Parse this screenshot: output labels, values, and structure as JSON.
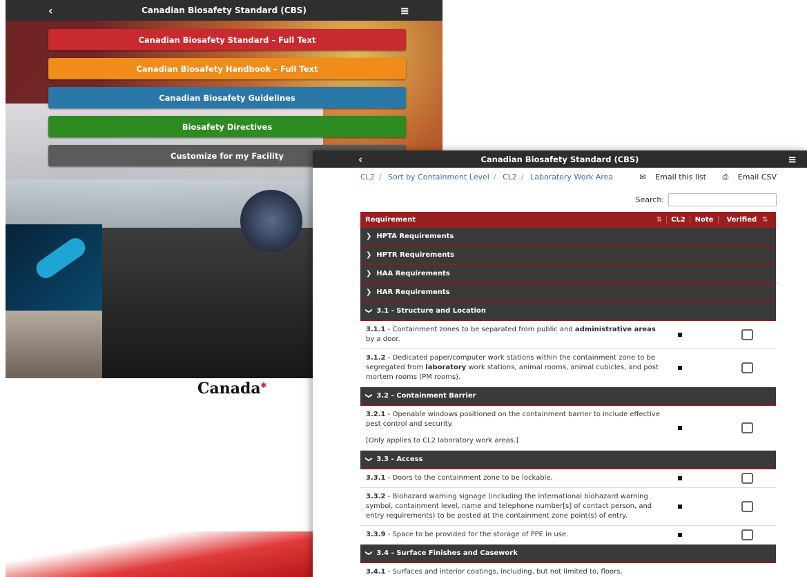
{
  "left_app": {
    "title": "Canadian Biosafety Standard (CBS)",
    "back_icon": "‹",
    "menu_icon": "≡",
    "buttons": [
      {
        "label": "Canadian Biosafety Standard – Full Text",
        "color": "#c82a30"
      },
      {
        "label": "Canadian Biosafety Handbook – Full Text",
        "color": "#f08c1a"
      },
      {
        "label": "Canadian Biosafety Guidelines",
        "color": "#2a78a8"
      },
      {
        "label": "Biosafety Directives",
        "color": "#2e8b22"
      },
      {
        "label": "Customize for my Facility",
        "color": "#5b5b5b"
      }
    ],
    "wordmark": "Canada"
  },
  "right_app": {
    "title": "Canadian Biosafety Standard (CBS)",
    "back_icon": "‹",
    "menu_icon": "≡",
    "breadcrumb": [
      "CL2",
      "Sort by Containment Level",
      "CL2",
      "Laboratory Work Area"
    ],
    "email_list": "Email this list",
    "email_csv": "Email CSV",
    "search_label": "Search:",
    "table": {
      "headers": {
        "requirement": "Requirement",
        "cl2": "CL2",
        "note": "Note",
        "verified": "Verified"
      },
      "collapsed_groups": [
        "HPTA Requirements",
        "HPTR Requirements",
        "HAA Requirements",
        "HAR Requirements"
      ],
      "sections": [
        {
          "title": "3.1 - Structure and Location",
          "rows": [
            {
              "num": "3.1.1",
              "text": " - Containment zones to be separated from public and ",
              "bold": "administrative areas",
              "tail": " by a door."
            },
            {
              "num": "3.1.2",
              "text": " - Dedicated paper/computer work stations within the containment zone to be segregated from ",
              "bold": "laboratory",
              "tail": " work stations, animal rooms, animal cubicles, and post mortem rooms (PM rooms)."
            }
          ]
        },
        {
          "title": "3.2 - Containment Barrier",
          "rows": [
            {
              "num": "3.2.1",
              "text": " - Openable windows positioned on the containment barrier to include effective pest control and security.",
              "note": "[Only applies to CL2 laboratory work areas.]"
            }
          ]
        },
        {
          "title": "3.3 - Access",
          "rows": [
            {
              "num": "3.3.1",
              "text": " - Doors to the containment zone to be lockable."
            },
            {
              "num": "3.3.2",
              "text": " - Biohazard warning signage (including the international biohazard warning symbol, containment level, name and telephone number[s] of contact person, and entry requirements) to be posted at the containment zone point(s) of entry."
            },
            {
              "num": "3.3.9",
              "text": " - Space to be provided for the storage of PPE in use."
            }
          ]
        },
        {
          "title": "3.4 - Surface Finishes and Casework",
          "rows": [
            {
              "num": "3.4.1",
              "text": " - Surfaces and interior coatings, including, but not limited to, floors,"
            }
          ]
        }
      ]
    }
  }
}
